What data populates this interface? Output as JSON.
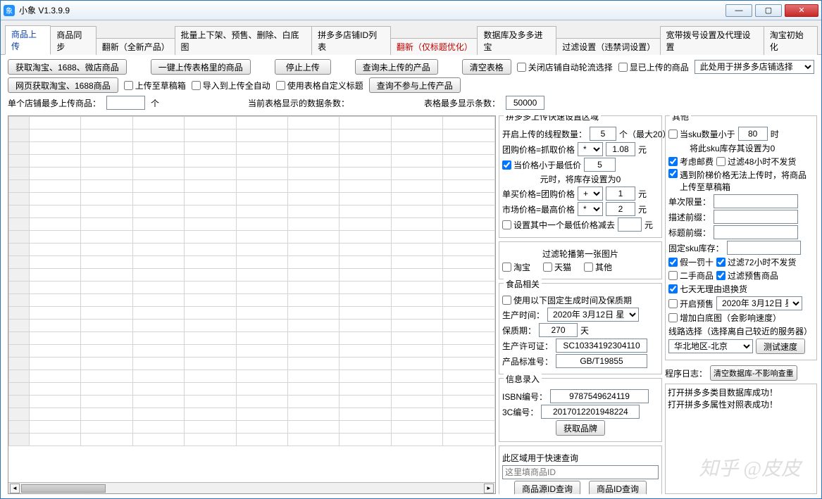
{
  "window": {
    "title": "小象 V1.3.9.9"
  },
  "tabs": [
    {
      "label": "商品上传",
      "active": true,
      "red": false
    },
    {
      "label": "商品同步"
    },
    {
      "label": "翻新（全新产品）"
    },
    {
      "label": "批量上下架、预售、删除、白底图"
    },
    {
      "label": "拼多多店铺ID列表"
    },
    {
      "label": "翻新（仅标题优化）",
      "red": true
    },
    {
      "label": "数据库及多多进宝"
    },
    {
      "label": "过滤设置（违禁词设置）"
    },
    {
      "label": "宽带拨号设置及代理设置"
    },
    {
      "label": "淘宝初始化"
    }
  ],
  "toolbar": {
    "btn_fetch_tb": "获取淘宝、1688、微店商品",
    "btn_one_click": "一键上传表格里的商品",
    "btn_stop": "停止上传",
    "btn_query_not_upload": "查询未上传的产品",
    "btn_clear_table": "清空表格",
    "chk_close_auto": "关闭店铺自动轮流选择",
    "chk_show_uploaded": "显已上传的商品",
    "shop_sel": "此处用于拼多多店铺选择",
    "btn_fetch_web": "网页获取淘宝、1688商品",
    "chk_to_draft": "上传至草稿箱",
    "chk_import_auto": "导入到上传全自动",
    "chk_custom_title": "使用表格自定义标题",
    "btn_query_skip": "查询不参与上传产品",
    "lbl_shop_max": "单个店铺最多上传商品：",
    "shop_max_val": "",
    "lbl_shop_unit": "个",
    "lbl_cur_rows": "当前表格显示的数据条数：",
    "lbl_max_rows": "表格最多显示条数：",
    "max_rows_val": "50000"
  },
  "pdd": {
    "legend": "拼多多上传快速设置区域",
    "thread_lbl": "开启上传的线程数量：",
    "thread_val": "5",
    "thread_unit": "个（最大20）",
    "group_lbl": "团购价格=抓取价格",
    "group_op": "*",
    "group_val": "1.08",
    "group_unit": "元",
    "whenlow_chk": "当价格小于最低价",
    "whenlow_val": "5",
    "whenlow_note": "元时，将库存设置为0",
    "single_lbl": "单买价格=团购价格",
    "single_op": "+",
    "single_val": "1",
    "single_unit": "元",
    "market_lbl": "市场价格=最高价格",
    "market_op": "*",
    "market_val": "2",
    "market_unit": "元",
    "minus_chk": "设置其中一个最低价格减去",
    "minus_val": "",
    "minus_unit": "元"
  },
  "carousel": {
    "title": "过滤轮播第一张图片",
    "chk_taobao": "淘宝",
    "chk_tmall": "天猫",
    "chk_other": "其他"
  },
  "food": {
    "legend": "食品相关",
    "chk_fixed": "使用以下固定生成时间及保质期",
    "prod_date_lbl": "生产时间：",
    "prod_date_val": "2020年 3月12日 星",
    "shelf_lbl": "保质期：",
    "shelf_val": "270",
    "shelf_unit": "天",
    "license_lbl": "生产许可证：",
    "license_val": "SC10334192304110",
    "std_lbl": "产品标准号：",
    "std_val": "GB/T19855"
  },
  "info": {
    "legend": "信息录入",
    "isbn_lbl": "ISBN编号：",
    "isbn_val": "9787549624119",
    "ccc_lbl": "3C编号：",
    "ccc_val": "2017012201948224",
    "btn_brand": "获取品牌"
  },
  "quick": {
    "title": "此区域用于快速查询",
    "placeholder": "这里填商品ID",
    "btn_src": "商品源ID查询",
    "btn_id": "商品ID查询"
  },
  "other": {
    "legend": "其他",
    "sku_lbl1": "当sku数量小于",
    "sku_val": "80",
    "sku_lbl2": "时",
    "sku_note": "将此sku库存其设置为0",
    "chk_postage": "考虑邮费",
    "chk_48h": "过滤48小时不发货",
    "chk_ladder": "遇到阶梯价格无法上传时，将商品上传至草稿箱",
    "single_limit_lbl": "单次限量：",
    "single_limit_val": "",
    "desc_prefix_lbl": "描述前缀：",
    "desc_prefix_val": "",
    "title_prefix_lbl": "标题前缀：",
    "title_prefix_val": "",
    "fixed_stock_lbl": "固定sku库存：",
    "fixed_stock_val": "",
    "chk_fake": "假一罚十",
    "chk_72h": "过滤72小时不发货",
    "chk_second": "二手商品",
    "chk_presale_filter": "过滤预售商品",
    "chk_7days": "七天无理由退换货",
    "chk_presale": "开启预售",
    "presale_date": "2020年 3月12日 星",
    "chk_whitebg": "增加白底图（会影响速度）",
    "route_lbl": "线路选择（选择离自己较近的服务器）",
    "route_val": "华北地区-北京",
    "btn_speed": "测试速度"
  },
  "log": {
    "lbl": "程序日志：",
    "btn_clear": "清空数据库-不影响查重",
    "lines": [
      "打开拼多多类目数据库成功！",
      "打开拼多多属性对照表成功！"
    ]
  },
  "watermark": "知乎 @皮皮"
}
